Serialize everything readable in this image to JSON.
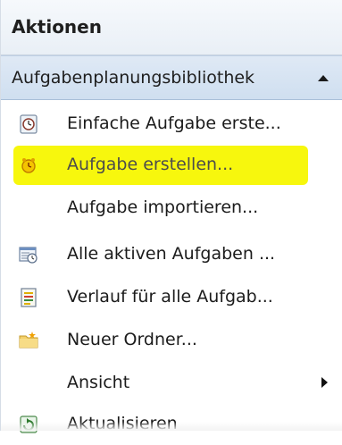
{
  "panel": {
    "title": "Aktionen",
    "section": {
      "label": "Aufgabenplanungsbibliothek",
      "icon": "collapse-up-arrow-icon"
    },
    "items": [
      {
        "label": "Einfache Aufgabe erste...",
        "icon": "clock-basic-task-icon"
      },
      {
        "label": "Aufgabe erstellen...",
        "icon": "clock-create-task-icon",
        "highlight_color": "#f7f700"
      },
      {
        "label": "Aufgabe importieren...",
        "icon": ""
      },
      {
        "label": "Alle aktiven Aufgaben ...",
        "icon": "calendar-tasks-icon"
      },
      {
        "label": "Verlauf für alle Aufgab...",
        "icon": "history-list-icon"
      },
      {
        "label": "Neuer Ordner...",
        "icon": "new-folder-icon"
      },
      {
        "label": "Ansicht",
        "icon": "",
        "submenu": "submenu-arrow-icon"
      },
      {
        "label": "Aktualisieren",
        "icon": "refresh-icon"
      }
    ]
  }
}
